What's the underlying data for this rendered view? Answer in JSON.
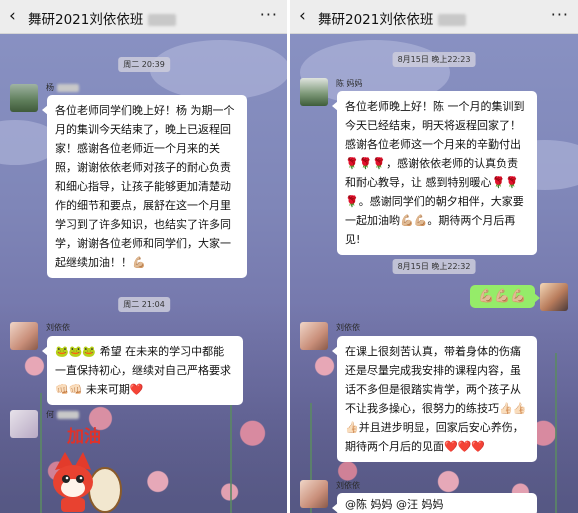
{
  "left": {
    "title": "舞研2021刘依依班",
    "menu": "···",
    "time1": "周二 20:39",
    "msg1_sender": "杨",
    "msg1_text": "各位老师同学们晚上好！杨      为期一个月的集训今天结束了，晚上已返程回家！感谢各位老师近一个月来的关照，谢谢依依老师对孩子的耐心负责和细心指导，让孩子能够更加清楚动作的细节和要点，展舒在这一个月里学习到了许多知识，也结实了许多同学，谢谢各位老师和同学们，大家一起继续加油！！💪🏼",
    "time2": "周二 21:04",
    "msg2_sender": "刘依依",
    "msg2_text": "🐸🐸🐸 希望      在未来的学习中都能一直保持初心，继续对自己严格要求👊🏻👊🏻 未来可期❤️",
    "msg3_sender": "何",
    "sticker_text": "加油"
  },
  "right": {
    "title": "舞研2021刘依依班",
    "menu": "···",
    "time1": "8月15日 晚上22:23",
    "msg1_sender": "陈      妈妈",
    "msg1_text": "各位老师晚上好！陈      一个月的集训到今天已经结束，明天将返程回家了！感谢各位老师这一个月来的辛勤付出🌹🌹🌹，感谢依依老师的认真负责和耐心教导，让      感到特别暖心🌹🌹🌹。感谢同学们的朝夕相伴，大家要一起加油哟💪🏼💪🏼。期待两个月后再见!",
    "time2": "8月15日 晚上22:32",
    "own_msg": "💪🏼💪🏼💪🏼",
    "msg2_sender": "刘依依",
    "msg2_text": "      在课上很刻苦认真，带着身体的伤痛还是尽量完成我安排的课程内容，虽话不多但是很踏实肯学，两个孩子从不让我多操心，很努力的练技巧👍🏻👍🏻👍🏻并且进步明显，回家后安心养伤，期待两个月后的见面❤️❤️❤️",
    "msg3_sender": "刘依依",
    "msg3_text": "@陈      妈妈  @汪      妈妈"
  },
  "colors": {
    "bubble": "#ffffff",
    "own_bubble": "#95ec69",
    "topbar": "#ededed"
  }
}
